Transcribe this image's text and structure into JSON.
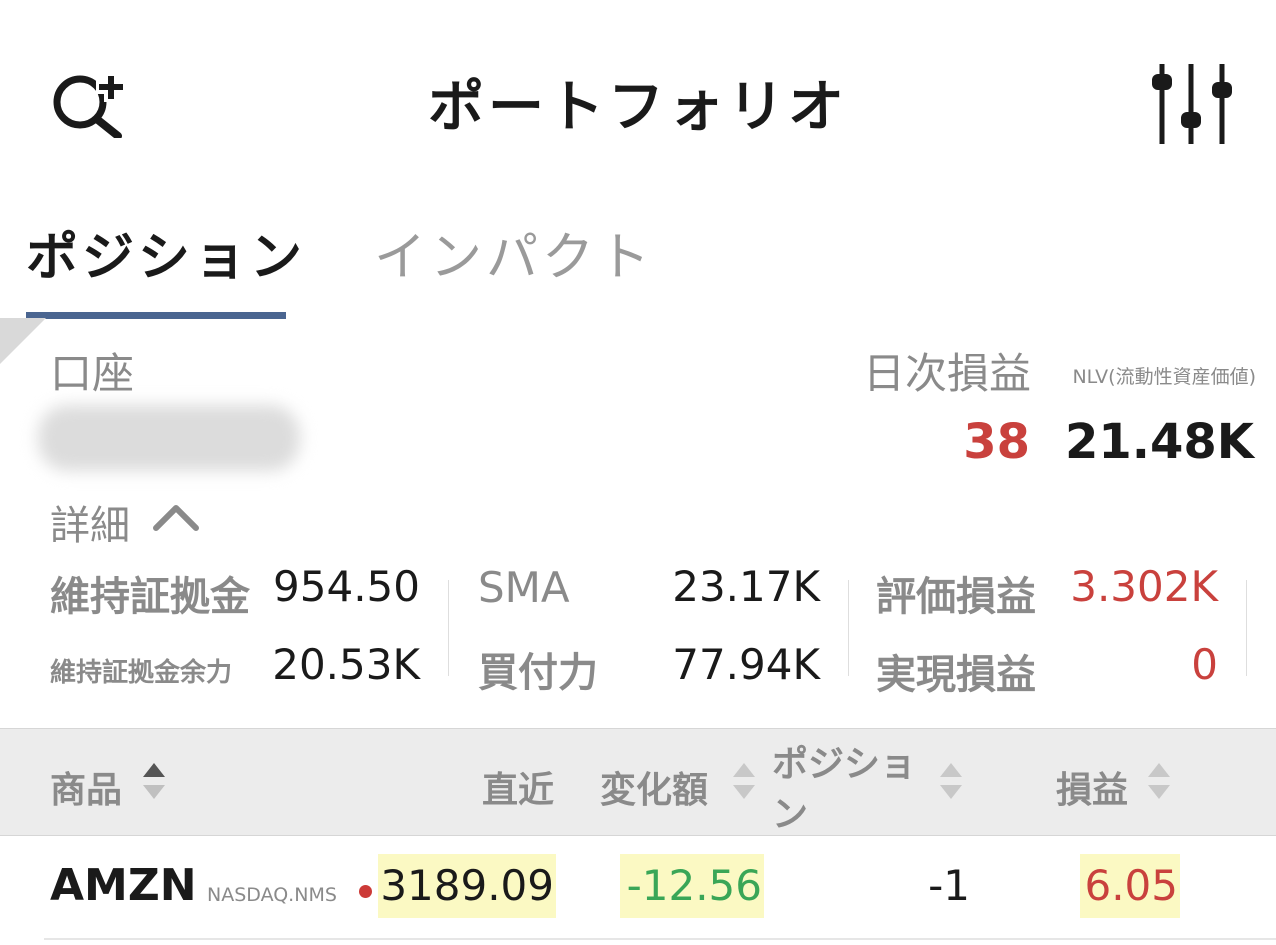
{
  "header": {
    "title": "ポートフォリオ",
    "left_icon": "search-add-icon",
    "right_icon": "sliders-icon"
  },
  "tabs": [
    {
      "label": "ポジション",
      "active": true
    },
    {
      "label": "インパクト",
      "active": false
    }
  ],
  "account": {
    "label": "口座",
    "daily_pnl_label": "日次損益",
    "nlv_label": "NLV(流動性資産価値)",
    "daily_pnl_value": "38",
    "nlv_value": "21.48K",
    "details_label": "詳細"
  },
  "metrics": {
    "maintenance_margin": {
      "label": "維持証拠金",
      "value": "954.50"
    },
    "excess_liquidity": {
      "label": "維持証拠金余力",
      "value": "20.53K"
    },
    "sma": {
      "label": "SMA",
      "value": "23.17K"
    },
    "buying_power": {
      "label": "買付力",
      "value": "77.94K"
    },
    "unrealized_pnl": {
      "label": "評価損益",
      "value": "3.302K"
    },
    "realized_pnl": {
      "label": "実現損益",
      "value": "0"
    }
  },
  "table": {
    "headers": {
      "instrument": "商品",
      "last": "直近",
      "change": "変化額",
      "position_line1": "ポジショ",
      "position_line2": "ン",
      "pnl": "損益"
    },
    "rows": [
      {
        "symbol": "AMZN",
        "exchange": "NASDAQ.NMS",
        "last": "3189.09",
        "change": "-12.56",
        "position": "-1",
        "pnl": "6.05"
      }
    ]
  },
  "colors": {
    "negative_red": "#c9413d",
    "positive_green": "#3aa657",
    "highlight_yellow": "#fbf9c3",
    "tab_underline": "#4a6590"
  }
}
